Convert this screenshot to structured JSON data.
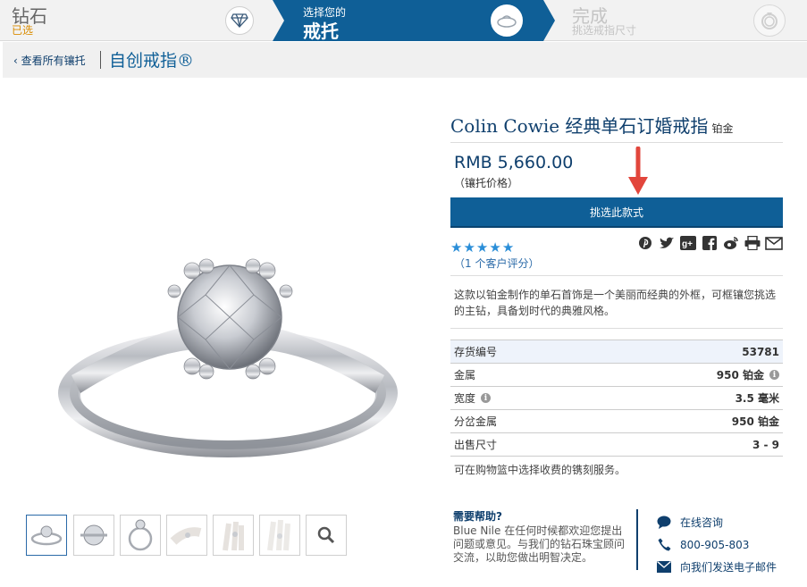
{
  "steps": [
    {
      "title": "钻石",
      "status": "已选",
      "icon": "diamond-icon"
    },
    {
      "subtitle": "选择您的",
      "title": "戒托",
      "icon": "ring-setting-icon"
    },
    {
      "title": "完成",
      "subtitle": "挑选戒指尺寸",
      "icon": "ring-icon"
    }
  ],
  "breadcrumb": {
    "back": "‹ 查看所有镶托",
    "title": "自创戒指®"
  },
  "product": {
    "name": "Colin Cowie 经典单石订婚戒指",
    "metal_tag": "铂金",
    "price": "RMB 5,660.00",
    "price_note": "（镶托价格）",
    "select_button": "挑选此款式",
    "rating_stars": 5,
    "rating_max": 5,
    "reviews": "（1 个客户评分）",
    "description": "这款以铂金制作的单石首饰是一个美丽而经典的外框，可框镶您挑选的主钻，具备划时代的典雅风格。",
    "engraving_note": "可在购物篮中选择收费的镌刻服务。"
  },
  "specs": [
    {
      "label": "存货编号",
      "value": "53781",
      "label_info": false,
      "value_info": false
    },
    {
      "label": "金属",
      "value": "950 铂金",
      "label_info": false,
      "value_info": true
    },
    {
      "label": "宽度",
      "value": "3.5 毫米",
      "label_info": true,
      "value_info": false
    },
    {
      "label": "分岔金属",
      "value": "950 铂金",
      "label_info": false,
      "value_info": false
    },
    {
      "label": "出售尺寸",
      "value": "3 - 9",
      "label_info": false,
      "value_info": false
    }
  ],
  "share_icons": [
    "pinterest-icon",
    "twitter-icon",
    "google-plus-icon",
    "facebook-icon",
    "weibo-icon",
    "print-icon",
    "email-icon"
  ],
  "thumbnails": [
    "front-view",
    "top-view",
    "side-view",
    "hand-view-1",
    "hand-view-2",
    "hand-view-3"
  ],
  "help": {
    "heading": "需要帮助?",
    "body": "Blue Nile 在任何时候都欢迎您提出问题或意见。与我们的钻石珠宝顾问交流，以助您做出明智决定。"
  },
  "contacts": [
    {
      "icon": "chat-icon",
      "label": "在线咨询"
    },
    {
      "icon": "phone-icon",
      "label": "800-905-803"
    },
    {
      "icon": "email-icon",
      "label": "向我们发送电子邮件"
    }
  ],
  "colors": {
    "brand_blue": "#0f5f97",
    "dark_blue": "#0f3f6d",
    "accent_orange": "#d98c00",
    "arrow_red": "#e2463c",
    "star_blue": "#2a8ed8"
  }
}
